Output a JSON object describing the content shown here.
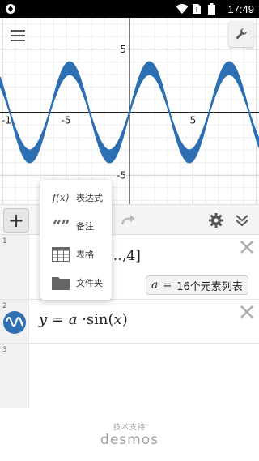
{
  "status_bar": {
    "time": "17:49",
    "icons": [
      "app-notification-icon",
      "wifi-icon",
      "no-sim-icon",
      "battery-icon"
    ]
  },
  "graph": {
    "x_ticks": [
      {
        "value": -10,
        "label": "-1"
      },
      {
        "value": -5,
        "label": "-5"
      },
      {
        "value": 5,
        "label": "5"
      }
    ],
    "y_ticks": [
      {
        "value": 5,
        "label": "5"
      },
      {
        "value": -5,
        "label": "-5"
      }
    ],
    "xlim": [
      -10.2,
      10.2
    ],
    "ylim": [
      -7.3,
      7.5
    ],
    "curve_color": "#2d70b3",
    "function": "y = a·sin(x)",
    "a_values": [
      3.0,
      3.066667,
      3.133333,
      3.2,
      3.266667,
      3.333333,
      3.4,
      3.466667,
      3.533333,
      3.6,
      3.666667,
      3.733333,
      3.8,
      3.866667,
      3.933333,
      4.0
    ]
  },
  "toolbar": {
    "add_label": "+"
  },
  "add_menu": {
    "items": [
      {
        "icon": "function-icon",
        "icon_text": "f(x)",
        "label": "表达式"
      },
      {
        "icon": "quote-icon",
        "icon_text": "“”",
        "label": "备注"
      },
      {
        "icon": "table-icon",
        "icon_text": "",
        "label": "表格"
      },
      {
        "icon": "folder-icon",
        "icon_text": "",
        "label": "文件夹"
      }
    ]
  },
  "expressions": {
    "row1": {
      "number": "1",
      "list_text": "…,4]",
      "slider_var": "a",
      "slider_eq": "=",
      "slider_value": "16个元素列表"
    },
    "row2": {
      "number": "2",
      "formula_lhs": "y",
      "formula_eq": "=",
      "formula_a": "a",
      "formula_dot": "·",
      "formula_fn": "sin(",
      "formula_x": "x",
      "formula_close": ")"
    },
    "row3": {
      "number": "3"
    }
  },
  "footer": {
    "powered_by": "技术支持",
    "brand": "desmos"
  },
  "colors": {
    "accent": "#2d70b3",
    "toolbar_bg": "#f5f5f5",
    "gutter_bg": "#f1f1f1"
  }
}
